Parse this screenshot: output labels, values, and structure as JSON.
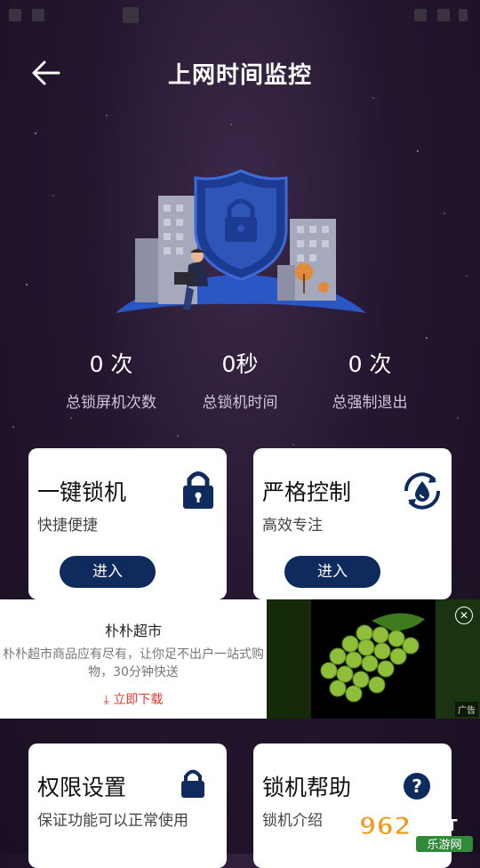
{
  "header": {
    "title": "上网时间监控"
  },
  "stats": [
    {
      "value": "0 次",
      "label": "总锁屏机次数"
    },
    {
      "value": "0秒",
      "label": "总锁机时间"
    },
    {
      "value": "0 次",
      "label": "总强制退出"
    }
  ],
  "cards": {
    "one_key_lock": {
      "title": "一键锁机",
      "subtitle": "快捷便捷",
      "button": "进入"
    },
    "strict_control": {
      "title": "严格控制",
      "subtitle": "高效专注",
      "button": "进入"
    },
    "permission": {
      "title": "权限设置",
      "subtitle": "保证功能可以正常使用"
    },
    "help": {
      "title": "锁机帮助",
      "subtitle": "锁机介绍"
    }
  },
  "ad": {
    "title": "朴朴超市",
    "description": "朴朴超市商品应有尽有，让你足不出户一站式购物，30分钟快送",
    "download": "立即下载",
    "badge": "广告",
    "close": "✕"
  },
  "watermark": {
    "number": "962",
    "net": ".NET",
    "site": "乐游网"
  },
  "colors": {
    "button": "#0f2a5c",
    "icon_blue": "#0f2a5c",
    "download_red": "#e23b2e"
  }
}
